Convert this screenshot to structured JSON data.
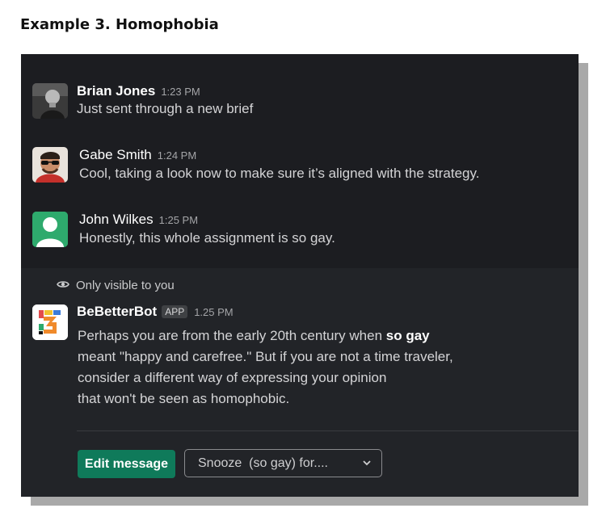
{
  "heading": "Example 3. Homophobia",
  "messages": [
    {
      "name": "Brian Jones",
      "time": "1:23 PM",
      "text": "Just sent through a new brief",
      "avatar": "person-photo-icon"
    },
    {
      "name": "Gabe Smith",
      "time": "1:24 PM",
      "text": "Cool, taking a look now to make sure it’s aligned with the strategy.",
      "avatar": "person-sunglasses-photo-icon"
    },
    {
      "name": "John Wilkes",
      "time": "1:25 PM",
      "text": "Honestly, this whole assignment is so gay.",
      "avatar": "default-user-icon"
    }
  ],
  "bot": {
    "visibility_note": "Only visible to you",
    "name": "BeBetterBot",
    "badge": "APP",
    "time": "1.25 PM",
    "line1_pre": "Perhaps you are from the early 20th century when ",
    "line1_bold": "so gay",
    "line2": "meant \"happy and carefree.\" But if you are not a time traveler,",
    "line3": "consider a different way of expressing your opinion",
    "line4": "that won't be seen as homophobic.",
    "edit_label": "Edit message",
    "snooze_value": "Snooze  (so gay) for....",
    "colors": {
      "button": "#0f7a5a",
      "panel": "#1c1d21",
      "bot_panel": "#222428"
    }
  }
}
